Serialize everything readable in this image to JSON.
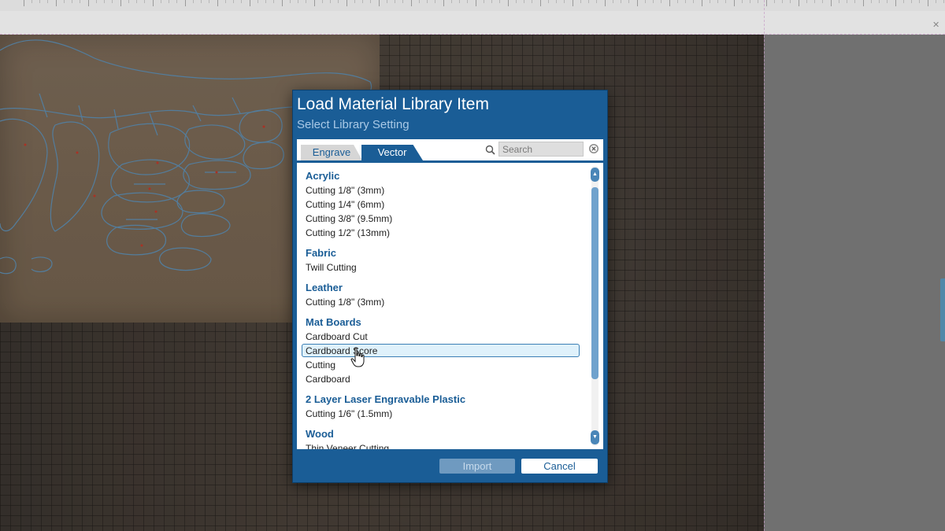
{
  "dialog": {
    "title": "Load Material Library Item",
    "subtitle": "Select Library Setting",
    "tabs": [
      {
        "label": "Engrave",
        "active": false
      },
      {
        "label": "Vector",
        "active": true
      }
    ],
    "search": {
      "placeholder": "Search",
      "value": "",
      "icon": "search-icon",
      "clear_icon": "close-circle-icon"
    },
    "library": [
      {
        "category": "Acrylic",
        "items": [
          "Cutting 1/8\" (3mm)",
          "Cutting 1/4\" (6mm)",
          "Cutting 3/8\" (9.5mm)",
          "Cutting 1/2\" (13mm)"
        ]
      },
      {
        "category": "Fabric",
        "items": [
          "Twill Cutting"
        ]
      },
      {
        "category": "Leather",
        "items": [
          "Cutting 1/8\" (3mm)"
        ]
      },
      {
        "category": "Mat Boards",
        "items": [
          "Cardboard Cut",
          "Cardboard Score",
          "Cutting",
          "Cardboard"
        ]
      },
      {
        "category": "2 Layer Laser Engravable Plastic",
        "items": [
          "Cutting 1/6\" (1.5mm)"
        ]
      },
      {
        "category": "Wood",
        "items": [
          "Thin Veneer Cutting"
        ]
      }
    ],
    "selected_item": "Cardboard Score",
    "buttons": {
      "import": "Import",
      "cancel": "Cancel"
    },
    "import_enabled": false
  },
  "colors": {
    "dialog_blue": "#1a5d96",
    "subtitle": "#a9c9e6",
    "selection_bg": "#dff1fb",
    "selection_border": "#3b7fb5"
  }
}
